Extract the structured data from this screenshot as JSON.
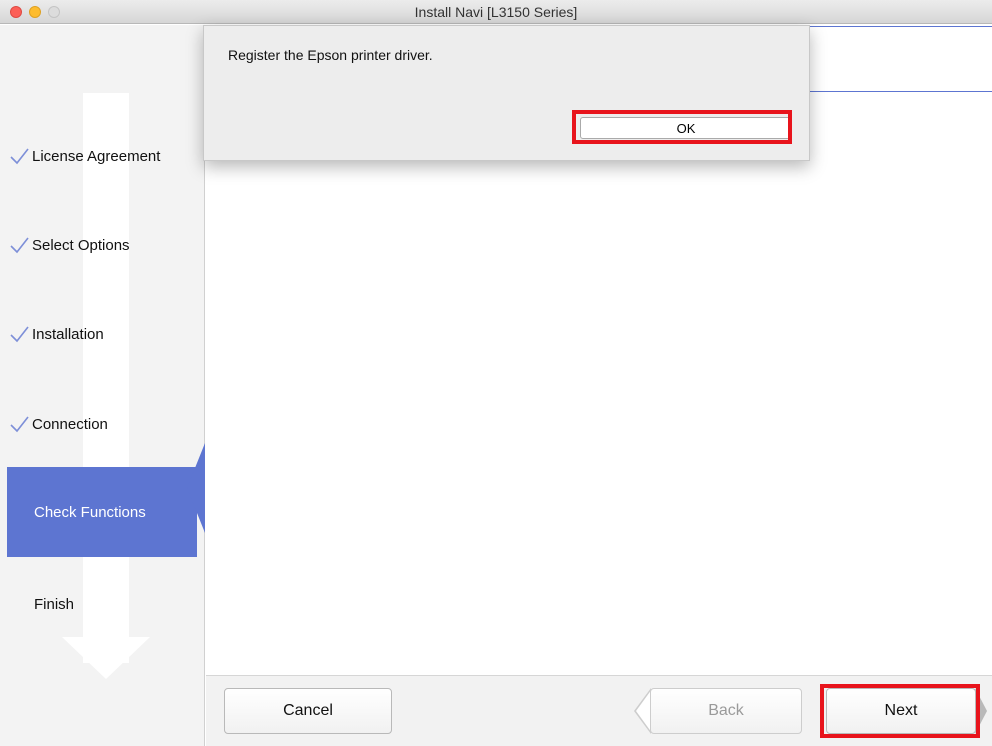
{
  "window": {
    "title": "Install Navi [L3150 Series]"
  },
  "sidebar": {
    "steps": [
      {
        "label": "License Agreement",
        "state": "done"
      },
      {
        "label": "Select Options",
        "state": "done"
      },
      {
        "label": "Installation",
        "state": "done"
      },
      {
        "label": "Connection",
        "state": "done"
      },
      {
        "label": "Check Functions",
        "state": "current"
      },
      {
        "label": "Finish",
        "state": "pending"
      }
    ]
  },
  "dialog": {
    "message": "Register the Epson printer driver.",
    "ok_label": "OK"
  },
  "footer": {
    "cancel_label": "Cancel",
    "back_label": "Back",
    "next_label": "Next"
  },
  "colors": {
    "accent": "#5d75d1",
    "highlight": "#e8141c"
  }
}
